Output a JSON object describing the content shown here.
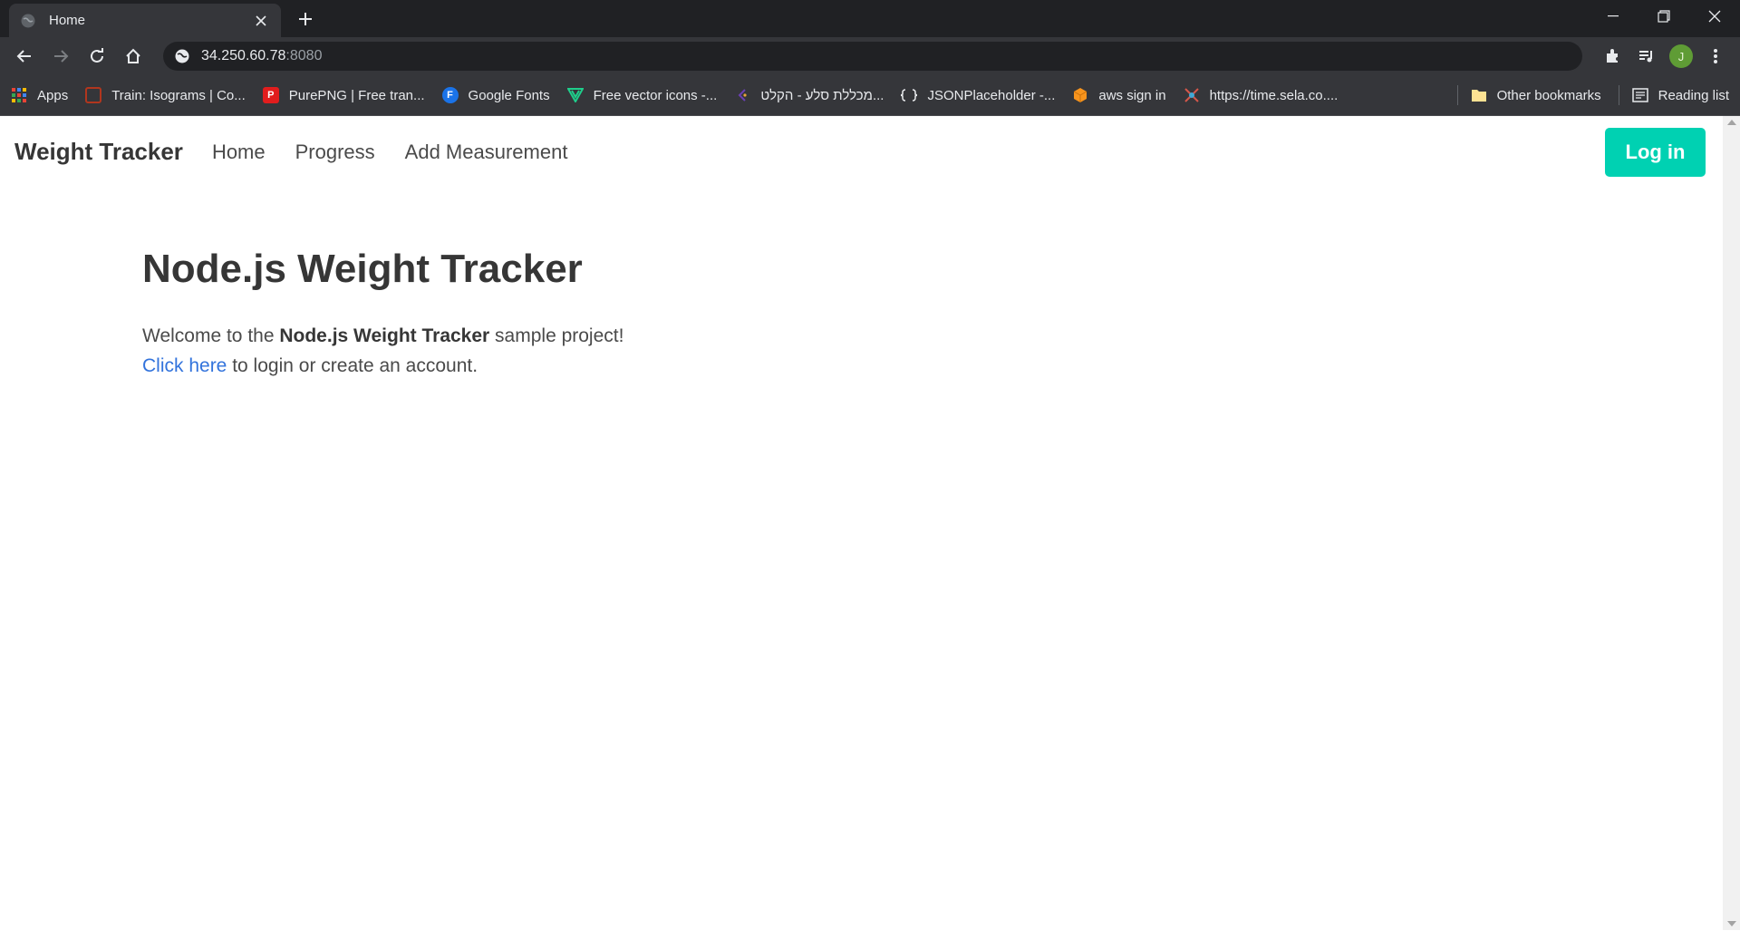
{
  "browser": {
    "tab_title": "Home",
    "url_host": "34.250.60.78",
    "url_port": ":8080",
    "profile_initial": "J",
    "bookmarks": [
      {
        "label": "Apps",
        "icon": "apps-grid-icon"
      },
      {
        "label": "Train: Isograms | Co...",
        "icon": "codewars-icon",
        "color": "#b1361e"
      },
      {
        "label": "PurePNG | Free tran...",
        "icon": "purepng-icon",
        "color": "#e11d1d"
      },
      {
        "label": "Google Fonts",
        "icon": "google-fonts-icon",
        "color": "#1a73e8"
      },
      {
        "label": "Free vector icons -...",
        "icon": "vector-icons-icon",
        "color": "#1fce8b"
      },
      {
        "label": "מכללת סלע - הקלט...",
        "icon": "sela-icon",
        "color": "#6a3fb5"
      },
      {
        "label": "JSONPlaceholder -...",
        "icon": "jsonplaceholder-icon"
      },
      {
        "label": "aws sign in",
        "icon": "aws-icon",
        "color": "#f7941d"
      },
      {
        "label": "https://time.sela.co....",
        "icon": "sela-time-icon"
      }
    ],
    "other_bookmarks": "Other bookmarks",
    "reading_list": "Reading list"
  },
  "navbar": {
    "brand": "Weight Tracker",
    "links": [
      "Home",
      "Progress",
      "Add Measurement"
    ],
    "login": "Log in"
  },
  "main": {
    "title": "Node.js Weight Tracker",
    "welcome_prefix": "Welcome to the ",
    "welcome_bold": "Node.js Weight Tracker",
    "welcome_suffix": " sample project!",
    "link_text": "Click here",
    "link_suffix": " to login or create an account."
  },
  "colors": {
    "accent": "#00d1b2",
    "link": "#3273dc"
  }
}
